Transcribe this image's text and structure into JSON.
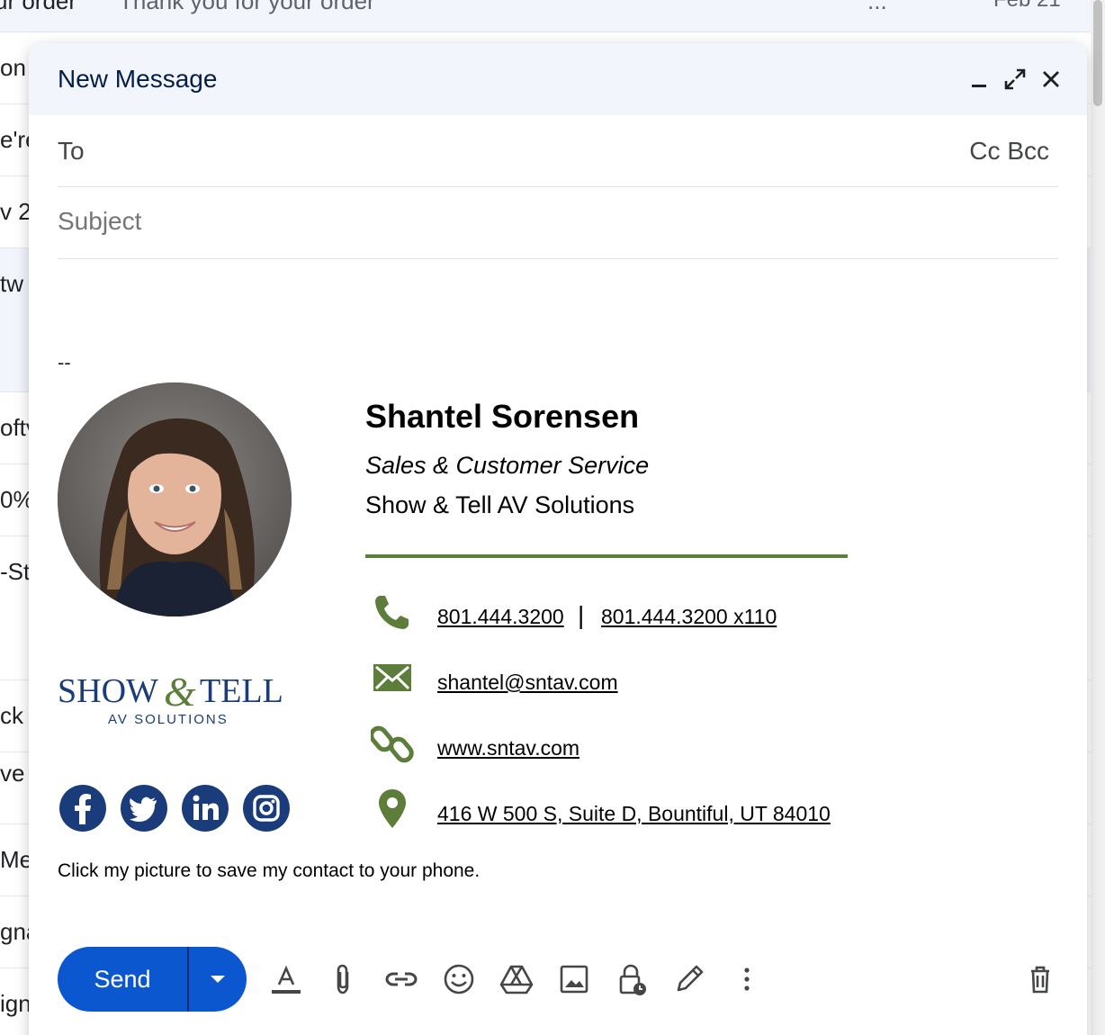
{
  "inbox": {
    "top_row": {
      "sender": "ur order",
      "snippet": "Thank you for your order",
      "more": "...",
      "date": "Feb 21"
    },
    "fragments": [
      "on",
      "e're",
      "v 2",
      "tw",
      "oftv",
      "0%",
      "-St",
      "",
      "ck",
      " ve",
      "Me",
      "gna",
      "ign"
    ]
  },
  "compose": {
    "title": "New Message",
    "header_icons": [
      "minimize-icon",
      "expand-icon",
      "close-icon"
    ],
    "to_label": "To",
    "cc_label": "Cc",
    "bcc_label": "Bcc",
    "subject_placeholder": "Subject",
    "signature": {
      "dash": "--",
      "name": "Shantel Sorensen",
      "role": "Sales & Customer Service",
      "company": "Show & Tell AV Solutions",
      "phone_1": "801.444.3200",
      "phone_sep": "|",
      "phone_2": "801.444.3200 x110",
      "email": "shantel@sntav.com",
      "website": "www.sntav.com",
      "address": "416 W 500 S, Suite D, Bountiful, UT 84010",
      "note": "Click my picture to save my contact to your phone.",
      "logo": {
        "line1": "SHOW & TELL",
        "line2": "AV SOLUTIONS"
      },
      "social": [
        "facebook-icon",
        "twitter-icon",
        "linkedin-icon",
        "instagram-icon"
      ],
      "accent_color": "#5d7e3a",
      "social_color": "#1b3c7b"
    },
    "toolbar": {
      "send_label": "Send",
      "tools": [
        "text-format-icon",
        "attach-icon",
        "link-icon",
        "emoji-icon",
        "drive-icon",
        "photo-icon",
        "confidential-icon",
        "signature-icon",
        "more-options-icon",
        "discard-icon"
      ]
    }
  }
}
